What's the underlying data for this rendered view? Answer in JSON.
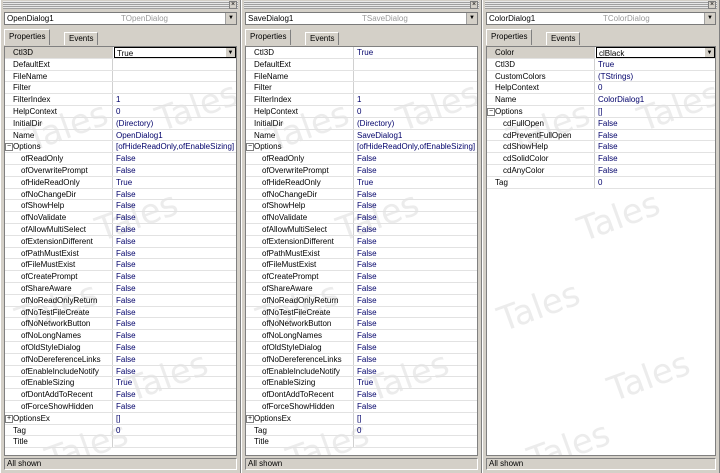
{
  "panels": [
    {
      "component_name": "OpenDialog1",
      "component_type": "TOpenDialog",
      "tabs": [
        "Properties",
        "Events"
      ],
      "status": "All shown",
      "selected_index": 0,
      "rows": [
        {
          "name": "Ctl3D",
          "value": "True"
        },
        {
          "name": "DefaultExt",
          "value": ""
        },
        {
          "name": "FileName",
          "value": ""
        },
        {
          "name": "Filter",
          "value": ""
        },
        {
          "name": "FilterIndex",
          "value": "1"
        },
        {
          "name": "HelpContext",
          "value": "0"
        },
        {
          "name": "InitialDir",
          "value": "(Directory)"
        },
        {
          "name": "Name",
          "value": "OpenDialog1"
        },
        {
          "name": "Options",
          "value": "[ofHideReadOnly,ofEnableSizing]",
          "expander": "⊟"
        },
        {
          "name": "ofReadOnly",
          "value": "False",
          "sub": true
        },
        {
          "name": "ofOverwritePrompt",
          "value": "False",
          "sub": true
        },
        {
          "name": "ofHideReadOnly",
          "value": "True",
          "sub": true
        },
        {
          "name": "ofNoChangeDir",
          "value": "False",
          "sub": true
        },
        {
          "name": "ofShowHelp",
          "value": "False",
          "sub": true
        },
        {
          "name": "ofNoValidate",
          "value": "False",
          "sub": true
        },
        {
          "name": "ofAllowMultiSelect",
          "value": "False",
          "sub": true
        },
        {
          "name": "ofExtensionDifferent",
          "value": "False",
          "sub": true
        },
        {
          "name": "ofPathMustExist",
          "value": "False",
          "sub": true
        },
        {
          "name": "ofFileMustExist",
          "value": "False",
          "sub": true
        },
        {
          "name": "ofCreatePrompt",
          "value": "False",
          "sub": true
        },
        {
          "name": "ofShareAware",
          "value": "False",
          "sub": true
        },
        {
          "name": "ofNoReadOnlyReturn",
          "value": "False",
          "sub": true
        },
        {
          "name": "ofNoTestFileCreate",
          "value": "False",
          "sub": true
        },
        {
          "name": "ofNoNetworkButton",
          "value": "False",
          "sub": true
        },
        {
          "name": "ofNoLongNames",
          "value": "False",
          "sub": true
        },
        {
          "name": "ofOldStyleDialog",
          "value": "False",
          "sub": true
        },
        {
          "name": "ofNoDereferenceLinks",
          "value": "False",
          "sub": true
        },
        {
          "name": "ofEnableIncludeNotify",
          "value": "False",
          "sub": true
        },
        {
          "name": "ofEnableSizing",
          "value": "True",
          "sub": true
        },
        {
          "name": "ofDontAddToRecent",
          "value": "False",
          "sub": true
        },
        {
          "name": "ofForceShowHidden",
          "value": "False",
          "sub": true
        },
        {
          "name": "OptionsEx",
          "value": "[]",
          "expander": "⊞"
        },
        {
          "name": "Tag",
          "value": "0"
        },
        {
          "name": "Title",
          "value": ""
        }
      ]
    },
    {
      "component_name": "SaveDialog1",
      "component_type": "TSaveDialog",
      "tabs": [
        "Properties",
        "Events"
      ],
      "status": "All shown",
      "selected_index": -1,
      "rows": [
        {
          "name": "Ctl3D",
          "value": "True"
        },
        {
          "name": "DefaultExt",
          "value": ""
        },
        {
          "name": "FileName",
          "value": ""
        },
        {
          "name": "Filter",
          "value": ""
        },
        {
          "name": "FilterIndex",
          "value": "1"
        },
        {
          "name": "HelpContext",
          "value": "0"
        },
        {
          "name": "InitialDir",
          "value": "(Directory)"
        },
        {
          "name": "Name",
          "value": "SaveDialog1"
        },
        {
          "name": "Options",
          "value": "[ofHideReadOnly,ofEnableSizing]",
          "expander": "⊟"
        },
        {
          "name": "ofReadOnly",
          "value": "False",
          "sub": true
        },
        {
          "name": "ofOverwritePrompt",
          "value": "False",
          "sub": true
        },
        {
          "name": "ofHideReadOnly",
          "value": "True",
          "sub": true
        },
        {
          "name": "ofNoChangeDir",
          "value": "False",
          "sub": true
        },
        {
          "name": "ofShowHelp",
          "value": "False",
          "sub": true
        },
        {
          "name": "ofNoValidate",
          "value": "False",
          "sub": true
        },
        {
          "name": "ofAllowMultiSelect",
          "value": "False",
          "sub": true
        },
        {
          "name": "ofExtensionDifferent",
          "value": "False",
          "sub": true
        },
        {
          "name": "ofPathMustExist",
          "value": "False",
          "sub": true
        },
        {
          "name": "ofFileMustExist",
          "value": "False",
          "sub": true
        },
        {
          "name": "ofCreatePrompt",
          "value": "False",
          "sub": true
        },
        {
          "name": "ofShareAware",
          "value": "False",
          "sub": true
        },
        {
          "name": "ofNoReadOnlyReturn",
          "value": "False",
          "sub": true
        },
        {
          "name": "ofNoTestFileCreate",
          "value": "False",
          "sub": true
        },
        {
          "name": "ofNoNetworkButton",
          "value": "False",
          "sub": true
        },
        {
          "name": "ofNoLongNames",
          "value": "False",
          "sub": true
        },
        {
          "name": "ofOldStyleDialog",
          "value": "False",
          "sub": true
        },
        {
          "name": "ofNoDereferenceLinks",
          "value": "False",
          "sub": true
        },
        {
          "name": "ofEnableIncludeNotify",
          "value": "False",
          "sub": true
        },
        {
          "name": "ofEnableSizing",
          "value": "True",
          "sub": true
        },
        {
          "name": "ofDontAddToRecent",
          "value": "False",
          "sub": true
        },
        {
          "name": "ofForceShowHidden",
          "value": "False",
          "sub": true
        },
        {
          "name": "OptionsEx",
          "value": "[]",
          "expander": "⊞"
        },
        {
          "name": "Tag",
          "value": "0"
        },
        {
          "name": "Title",
          "value": ""
        }
      ]
    },
    {
      "component_name": "ColorDialog1",
      "component_type": "TColorDialog",
      "tabs": [
        "Properties",
        "Events"
      ],
      "status": "All shown",
      "selected_index": 0,
      "rows": [
        {
          "name": "Color",
          "value": "clBlack"
        },
        {
          "name": "Ctl3D",
          "value": "True"
        },
        {
          "name": "CustomColors",
          "value": "(TStrings)"
        },
        {
          "name": "HelpContext",
          "value": "0"
        },
        {
          "name": "Name",
          "value": "ColorDialog1"
        },
        {
          "name": "Options",
          "value": "[]",
          "expander": "⊟"
        },
        {
          "name": "cdFullOpen",
          "value": "False",
          "sub": true
        },
        {
          "name": "cdPreventFullOpen",
          "value": "False",
          "sub": true
        },
        {
          "name": "cdShowHelp",
          "value": "False",
          "sub": true
        },
        {
          "name": "cdSolidColor",
          "value": "False",
          "sub": true
        },
        {
          "name": "cdAnyColor",
          "value": "False",
          "sub": true
        },
        {
          "name": "Tag",
          "value": "0"
        }
      ]
    }
  ],
  "icons": {
    "close": "close-icon",
    "dropdown": "chevron-down-icon"
  },
  "watermark": "Tales"
}
